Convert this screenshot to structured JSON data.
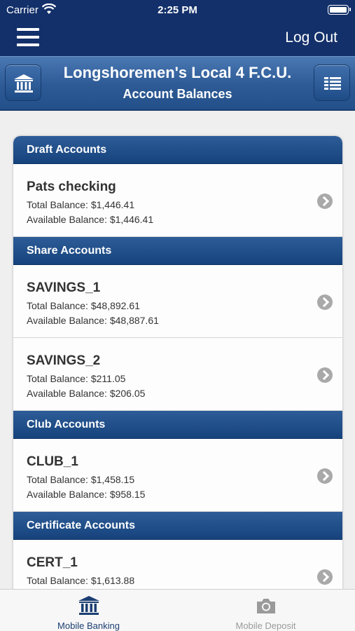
{
  "status_bar": {
    "carrier": "Carrier",
    "time": "2:25 PM"
  },
  "nav": {
    "logout_label": "Log Out"
  },
  "header": {
    "title": "Longshoremen's Local 4 F.C.U.",
    "subtitle": "Account Balances"
  },
  "sections": [
    {
      "title": "Draft Accounts",
      "accounts": [
        {
          "name": "Pats checking",
          "total": "Total Balance: $1,446.41",
          "available": "Available Balance: $1,446.41"
        }
      ]
    },
    {
      "title": "Share Accounts",
      "accounts": [
        {
          "name": "SAVINGS_1",
          "total": "Total Balance: $48,892.61",
          "available": "Available Balance: $48,887.61"
        },
        {
          "name": "SAVINGS_2",
          "total": "Total Balance: $211.05",
          "available": "Available Balance: $206.05"
        }
      ]
    },
    {
      "title": "Club Accounts",
      "accounts": [
        {
          "name": "CLUB_1",
          "total": "Total Balance: $1,458.15",
          "available": "Available Balance: $958.15"
        }
      ]
    },
    {
      "title": "Certificate Accounts",
      "accounts": [
        {
          "name": "CERT_1",
          "total": "Total Balance: $1,613.88",
          "available": ""
        }
      ]
    }
  ],
  "tabs": [
    {
      "label": "Mobile Banking",
      "icon": "bank-icon",
      "active": true
    },
    {
      "label": "Mobile Deposit",
      "icon": "camera-icon",
      "active": false
    }
  ],
  "colors": {
    "nav_bg": "#13306a",
    "header_bg": "#2d5a95",
    "section_bg": "#1e4d88",
    "active_tab": "#1c3f73",
    "inactive_tab": "#9a9a9a"
  }
}
